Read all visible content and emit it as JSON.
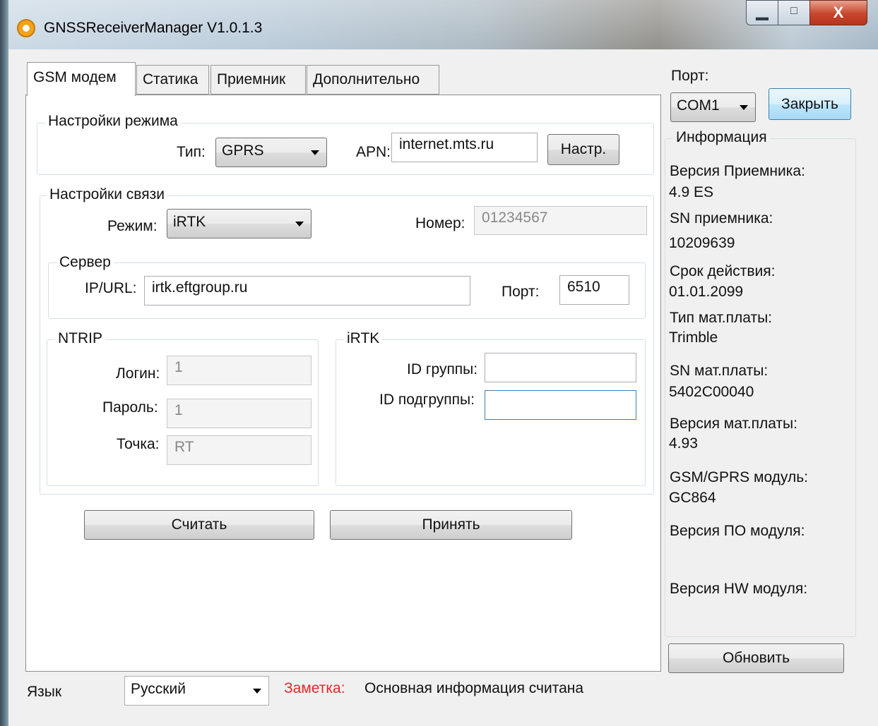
{
  "window": {
    "title": "GNSSReceiverManager V1.0.1.3",
    "min_glyph": "▁",
    "max_glyph": "□",
    "close_glyph": "X"
  },
  "tabs": [
    {
      "label": "GSM модем",
      "active": true
    },
    {
      "label": "Статика",
      "active": false
    },
    {
      "label": "Приемник",
      "active": false
    },
    {
      "label": "Дополнительно",
      "active": false
    }
  ],
  "mode_settings": {
    "legend": "Настройки режима",
    "type_label": "Тип:",
    "type_value": "GPRS",
    "apn_label": "APN:",
    "apn_value": "internet.mts.ru",
    "setup_button": "Настр."
  },
  "comm_settings": {
    "legend": "Настройки связи",
    "mode_label": "Режим:",
    "mode_value": "iRTK",
    "number_label": "Номер:",
    "number_value": "01234567"
  },
  "server": {
    "legend": "Сервер",
    "url_label": "IP/URL:",
    "url_value": "irtk.eftgroup.ru",
    "port_label": "Порт:",
    "port_value": "6510"
  },
  "ntrip": {
    "legend": "NTRIP",
    "login_label": "Логин:",
    "login_value": "1",
    "password_label": "Пароль:",
    "password_value": "1",
    "point_label": "Точка:",
    "point_value": "RT"
  },
  "irtk": {
    "legend": "iRTK",
    "group_id_label": "ID группы:",
    "group_id_value": "",
    "subgroup_id_label": "ID подгруппы:",
    "subgroup_id_value": ""
  },
  "actions": {
    "read_button": "Считать",
    "apply_button": "Принять"
  },
  "port_panel": {
    "label": "Порт:",
    "value": "COM1",
    "close_button": "Закрыть"
  },
  "info": {
    "legend": "Информация",
    "items": [
      {
        "label": "Версия Приемника:",
        "value": "4.9  ES"
      },
      {
        "label": "SN приемника:",
        "value": "10209639"
      },
      {
        "label": "Срок действия:",
        "value": "01.01.2099"
      },
      {
        "label": "Тип мат.платы:",
        "value": "Trimble"
      },
      {
        "label": "SN мат.платы:",
        "value": "5402C00040"
      },
      {
        "label": "Версия мат.платы:",
        "value": "4.93"
      },
      {
        "label": "GSM/GPRS модуль:",
        "value": "GC864"
      },
      {
        "label": "Версия ПО модуля:",
        "value": ""
      },
      {
        "label": "Версия HW модуля:",
        "value": ""
      }
    ],
    "refresh_button": "Обновить"
  },
  "footer": {
    "language_label": "Язык",
    "language_value": "Русский",
    "note_label": "Заметка:",
    "note_text": "Основная информация считана",
    "note_color": "#e8262b"
  }
}
